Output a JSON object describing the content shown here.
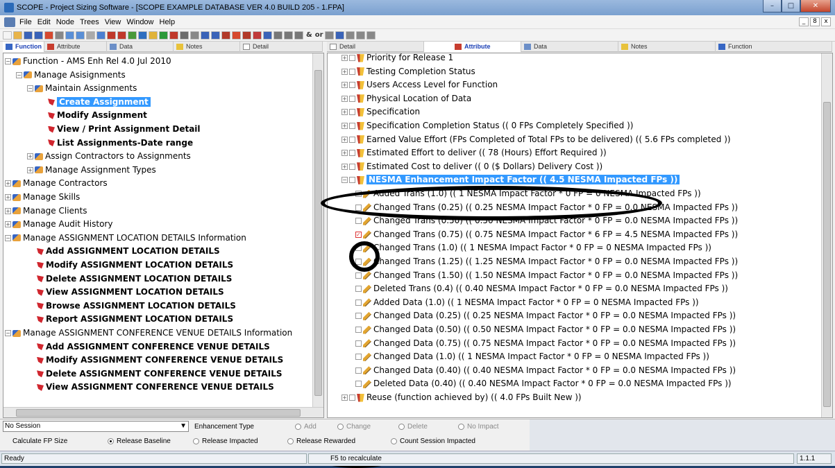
{
  "titlebar": {
    "title": "SCOPE - Project Sizing Software - [SCOPE EXAMPLE DATABASE VER 4.0 BUILD 205 - 1.FPA]",
    "min": "–",
    "max": "□",
    "close": "✕"
  },
  "menu": [
    "File",
    "Edit",
    "Node",
    "Trees",
    "View",
    "Window",
    "Help"
  ],
  "mdi_buttons": [
    "_",
    "8",
    "x"
  ],
  "toolbar_text": [
    "&",
    "or"
  ],
  "left_tabs": [
    {
      "label": "Function",
      "active": true
    },
    {
      "label": "Attribute"
    },
    {
      "label": "Data"
    },
    {
      "label": "Notes"
    },
    {
      "label": "Detail"
    }
  ],
  "right_tabs": [
    {
      "label": "Detail"
    },
    {
      "label": "Attribute",
      "active": true
    },
    {
      "label": "Data"
    },
    {
      "label": "Notes"
    },
    {
      "label": "Function"
    }
  ],
  "left_tree": [
    "Function - AMS Enh Rel 4.0 Jul 2010",
    "Manage Asisignments",
    "Maintain Assignments",
    "Create Assignment",
    "Modify Assignment",
    "View / Print Assignment Detail",
    "List Assignments-Date range",
    "Assign Contractors to Assignments",
    "Manage Assignment Types",
    "Manage Contractors",
    "Manage Skills",
    "Manage Clients",
    "Manage Audit History",
    "Manage ASSIGNMENT LOCATION DETAILS Information",
    "Add ASSIGNMENT LOCATION DETAILS",
    "Modify ASSIGNMENT LOCATION DETAILS",
    "Delete ASSIGNMENT LOCATION DETAILS",
    "View ASSIGNMENT LOCATION DETAILS",
    "Browse ASSIGNMENT LOCATION DETAILS",
    "Report ASSIGNMENT LOCATION DETAILS",
    "Manage ASSIGNMENT CONFERENCE VENUE DETAILS Information",
    "Add ASSIGNMENT CONFERENCE VENUE DETAILS",
    "Modify ASSIGNMENT CONFERENCE VENUE DETAILS",
    "Delete ASSIGNMENT CONFERENCE VENUE DETAILS",
    "View ASSIGNMENT CONFERENCE VENUE DETAILS"
  ],
  "right_tree": [
    "Priority for Release 1",
    "Testing Completion Status",
    "Users Access Level for Function",
    "Physical Location of Data",
    "Specification",
    "Specification Completion Status   (( 0  FPs Completely Specified ))",
    "Earned Value Effort  (FPs Completed of Total FPs to be delivered)        (( 5.6  FPs completed ))",
    "Estimated Effort to deliver   (( 78  (Hours)  Effort Required ))",
    "Estimated Cost to deliver   (( 0  ($ Dollars) Delivery Cost ))",
    "NESMA Enhancement Impact Factor         (( 4.5  NESMA Impacted FPs ))",
    "Added Trans (1.0)   (( 1 NESMA Impact Factor * 0 FP = 0 NESMA Impacted FPs ))",
    "Changed Trans (0.25)   (( 0.25 NESMA Impact Factor * 0 FP = 0.0 NESMA Impacted FPs ))",
    "Changed Trans (0.50)   (( 0.50 NESMA Impact Factor * 0 FP = 0.0 NESMA Impacted FPs ))",
    "Changed Trans (0.75)   (( 0.75 NESMA Impact Factor * 6 FP = 4.5 NESMA Impacted FPs ))",
    "Changed Trans (1.0)   (( 1 NESMA Impact Factor * 0 FP = 0 NESMA Impacted FPs ))",
    "Changed Trans (1.25)   (( 1.25 NESMA Impact Factor * 0 FP = 0.0 NESMA Impacted FPs ))",
    "Changed Trans (1.50)   (( 1.50 NESMA Impact Factor * 0 FP = 0.0 NESMA Impacted FPs ))",
    "Deleted Trans (0.4)   (( 0.40 NESMA Impact Factor * 0 FP = 0.0 NESMA Impacted FPs ))",
    "Added Data (1.0)   (( 1 NESMA Impact Factor * 0 FP = 0 NESMA Impacted FPs ))",
    "Changed Data (0.25)   (( 0.25 NESMA Impact Factor * 0 FP = 0.0 NESMA Impacted FPs ))",
    "Changed Data (0.50)   (( 0.50 NESMA Impact Factor * 0 FP = 0.0 NESMA Impacted FPs ))",
    "Changed Data (0.75)   (( 0.75 NESMA Impact Factor * 0 FP = 0.0 NESMA Impacted FPs ))",
    "Changed Data (1.0)   (( 1 NESMA Impact Factor * 0 FP = 0 NESMA Impacted FPs ))",
    "Changed Data (0.40)   (( 0.40 NESMA Impact Factor * 0 FP = 0.0 NESMA Impacted FPs ))",
    "Deleted Data (0.40)   (( 0.40 NESMA Impact Factor * 0 FP = 0.0 NESMA Impacted FPs ))",
    "Reuse (function achieved by)   (( 4.0  FPs Built New ))"
  ],
  "bottom": {
    "session_value": "No Session",
    "enhancement_type_label": "Enhancement Type",
    "enhancement_options": [
      "Add",
      "Change",
      "Delete",
      "No Impact"
    ],
    "calc_label": "Calculate FP Size",
    "calc_options": [
      "Release Baseline",
      "Release Impacted",
      "Release Rewarded",
      "Count Session Impacted"
    ]
  },
  "status": {
    "left": "Ready",
    "middle": "F5 to recalculate",
    "version": "1.1.1"
  }
}
